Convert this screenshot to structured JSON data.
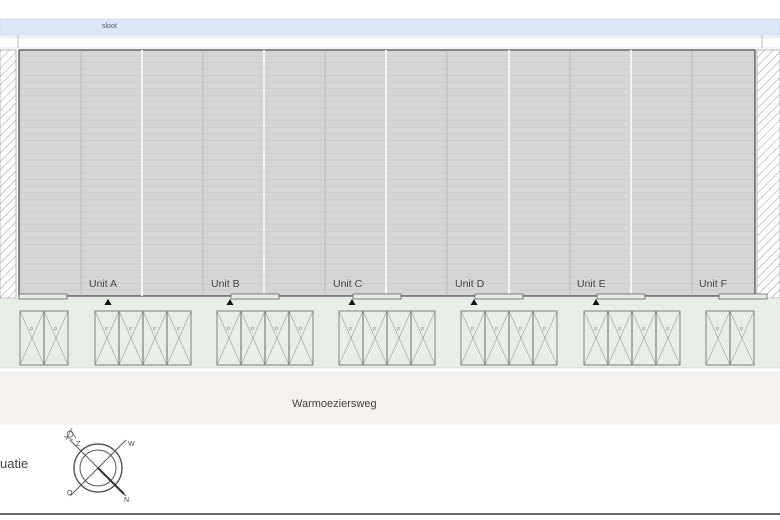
{
  "plan": {
    "water_label": "sloot",
    "road_label": "Warmoeziersweg",
    "side_text": "uatie",
    "compass_letters": [
      "N",
      "O",
      "Z",
      "W"
    ],
    "units": [
      {
        "label": "Unit A",
        "parking_spaces": 2
      },
      {
        "label": "Unit B",
        "parking_spaces": 4
      },
      {
        "label": "Unit C",
        "parking_spaces": 4
      },
      {
        "label": "Unit D",
        "parking_spaces": 4
      },
      {
        "label": "Unit E",
        "parking_spaces": 4
      },
      {
        "label": "Unit F",
        "parking_spaces": 4
      }
    ],
    "parking_marking": "P",
    "colors": {
      "water": "#dbe6f7",
      "roof": "#d6d6d6",
      "roof_lines": "#bdbdbd",
      "apron": "#e7eee6",
      "road": "#f4f1ee",
      "outline": "#555555"
    }
  }
}
